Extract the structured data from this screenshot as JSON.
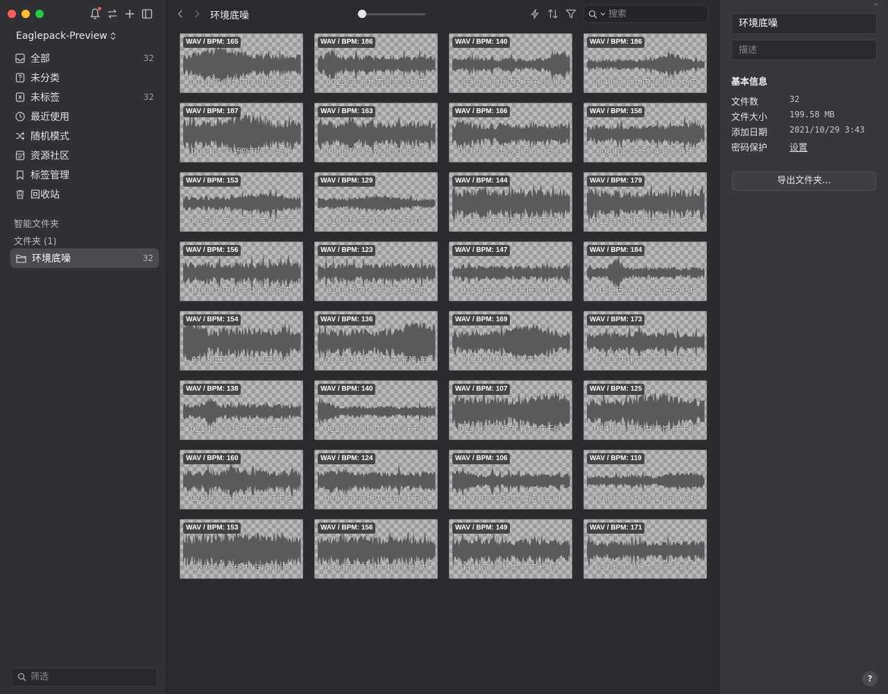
{
  "sidebar": {
    "library_name": "Eaglepack-Preview",
    "items": [
      {
        "label": "全部",
        "count": "32",
        "icon": "inbox-icon"
      },
      {
        "label": "未分类",
        "count": "",
        "icon": "question-box-icon"
      },
      {
        "label": "未标签",
        "count": "32",
        "icon": "untagged-icon"
      },
      {
        "label": "最近使用",
        "count": "",
        "icon": "clock-icon"
      },
      {
        "label": "随机模式",
        "count": "",
        "icon": "shuffle-icon"
      },
      {
        "label": "资源社区",
        "count": "",
        "icon": "community-icon"
      },
      {
        "label": "标签管理",
        "count": "",
        "icon": "bookmark-icon"
      },
      {
        "label": "回收站",
        "count": "",
        "icon": "trash-icon"
      }
    ],
    "smart_folders_label": "智能文件夹",
    "folders_label": "文件夹 (1)",
    "folder": {
      "label": "环境底噪",
      "count": "32"
    },
    "filter_placeholder": "筛选"
  },
  "toolbar": {
    "folder_title": "环境底噪",
    "search_placeholder": "搜索"
  },
  "grid": {
    "items": [
      {
        "badge": "WAV / BPM: 165",
        "name": "001街道 商场内(2)街道 商场"
      },
      {
        "badge": "WAV / BPM: 186",
        "name": "002街道 商场内街道 商场内"
      },
      {
        "badge": "WAV / BPM: 140",
        "name": "003街道 商场内2 孩子吵闹街"
      },
      {
        "badge": "WAV / BPM: 186",
        "name": "004街道 商场内2街道 商场内"
      },
      {
        "badge": "WAV / BPM: 187",
        "name": "005街道 商场外街道 商场外"
      },
      {
        "badge": "WAV / BPM: 163",
        "name": "006街道 商场外2街道 商场外"
      },
      {
        "badge": "WAV / BPM: 166",
        "name": "007街道 商场外3街道 商场外"
      },
      {
        "badge": "WAV / BPM: 158",
        "name": "008街道 商场外4街道 商场"
      },
      {
        "badge": "WAV / BPM: 153",
        "name": "009马路 车流 马路 车流 画音"
      },
      {
        "badge": "WAV / BPM: 129",
        "name": "010商场 玩具店商场 玩具店"
      },
      {
        "badge": "WAV / BPM: 144",
        "name": "011商场 玩具店2商场 玩具店"
      },
      {
        "badge": "WAV / BPM: 179",
        "name": "012商场内环境实录商场内环"
      },
      {
        "badge": "WAV / BPM: 156",
        "name": "013商场内环境实录2商场内"
      },
      {
        "badge": "WAV / BPM: 123",
        "name": "014商场内环境实录3商场内"
      },
      {
        "badge": "WAV / BPM: 147",
        "name": "015星巴克 环境星巴克 环境"
      },
      {
        "badge": "WAV / BPM: 184",
        "name": "016星巴克 环境2星巴克 环境"
      },
      {
        "badge": "WAV / BPM: 154",
        "name": "017星巴克 收银台星巴克 收"
      },
      {
        "badge": "WAV / BPM: 136",
        "name": "018车内环境 引擎声 底噪 车"
      },
      {
        "badge": "WAV / BPM: 169",
        "name": "019车内环境 引擎声 底噪 2"
      },
      {
        "badge": "WAV / BPM: 173",
        "name": "020车内环境 引擎声 底噪 3"
      },
      {
        "badge": "WAV / BPM: 138",
        "name": "021街道 商场内 餐馆 味千拉"
      },
      {
        "badge": "WAV / BPM: 140",
        "name": "022街道 商场内 餐馆 味千拉"
      },
      {
        "badge": "WAV / BPM: 107",
        "name": "023街道 商场内 餐馆 味千拉"
      },
      {
        "badge": "WAV / BPM: 125",
        "name": "024街道 商场内 餐馆 味千拉"
      },
      {
        "badge": "WAV / BPM: 160",
        "name": "025街道 商场内 餐馆 味千拉"
      },
      {
        "badge": "WAV / BPM: 124",
        "name": "026街道 商场内 餐馆 味千拉"
      },
      {
        "badge": "WAV / BPM: 106",
        "name": "027街道 商场内 魔法餐店门"
      },
      {
        "badge": "WAV / BPM: 119",
        "name": "028街道 商场内 (2)街道 商场"
      },
      {
        "badge": "WAV / BPM: 153",
        "name": "029街道 商场内 (3)街道 商"
      },
      {
        "badge": "WAV / BPM: 156",
        "name": "030街道 商场内 街道 商场内"
      },
      {
        "badge": "WAV / BPM: 149",
        "name": "031街道 商场内 孩子大喊大"
      },
      {
        "badge": "WAV / BPM: 171",
        "name": "032街道 商场内 孩子大喊大"
      }
    ]
  },
  "inspector": {
    "title": "环境底噪",
    "description_placeholder": "描述",
    "section": "基本信息",
    "rows": [
      {
        "key": "文件数",
        "value": "32"
      },
      {
        "key": "文件大小",
        "value": "199.58 MB"
      },
      {
        "key": "添加日期",
        "value": "2021/10/29 3:43"
      },
      {
        "key": "密码保护",
        "value": "设置"
      }
    ],
    "export_label": "导出文件夹...",
    "help_label": "?"
  },
  "colors": {
    "sidebar_bg": "#303134",
    "main_bg": "#2b2c2f",
    "inspector_bg": "#36373a",
    "selected_bg": "#4a4b4f",
    "waveform": "#5a5a5c"
  }
}
